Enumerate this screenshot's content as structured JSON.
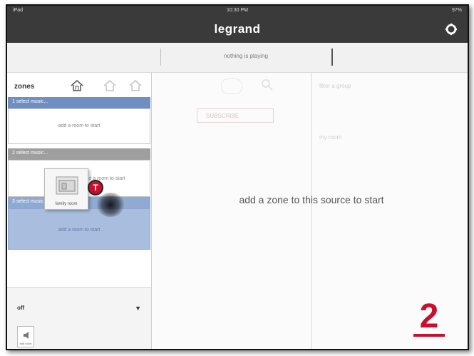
{
  "status_bar": {
    "carrier": "iPad",
    "time": "10:30 PM",
    "battery": "97%"
  },
  "app": {
    "brand": "legrand"
  },
  "toolbar": {
    "now_playing": "nothing is playing"
  },
  "sidebar": {
    "header": "zones",
    "zones": [
      {
        "bar_label": "1 select music...",
        "hint": "add a room to start"
      },
      {
        "bar_label": "2 select music...",
        "hint": "add a room to start"
      },
      {
        "bar_label": "3 select music...",
        "hint": "add a room to start"
      }
    ],
    "drag_card_label": "family room",
    "bottom": {
      "power": "off",
      "room_button": "add room"
    }
  },
  "main": {
    "message": "add a zone to this source to start",
    "ghost": {
      "button": "SUBSCRIBE",
      "filter": "filter a group",
      "list": "my room"
    }
  },
  "annotations": {
    "badge": "T",
    "step": "2"
  },
  "colors": {
    "accent_blue": "#6f8fc3",
    "gray_bar": "#9f9f9f",
    "badge_red": "#c8102e",
    "title_bg": "#3a3a3a"
  }
}
